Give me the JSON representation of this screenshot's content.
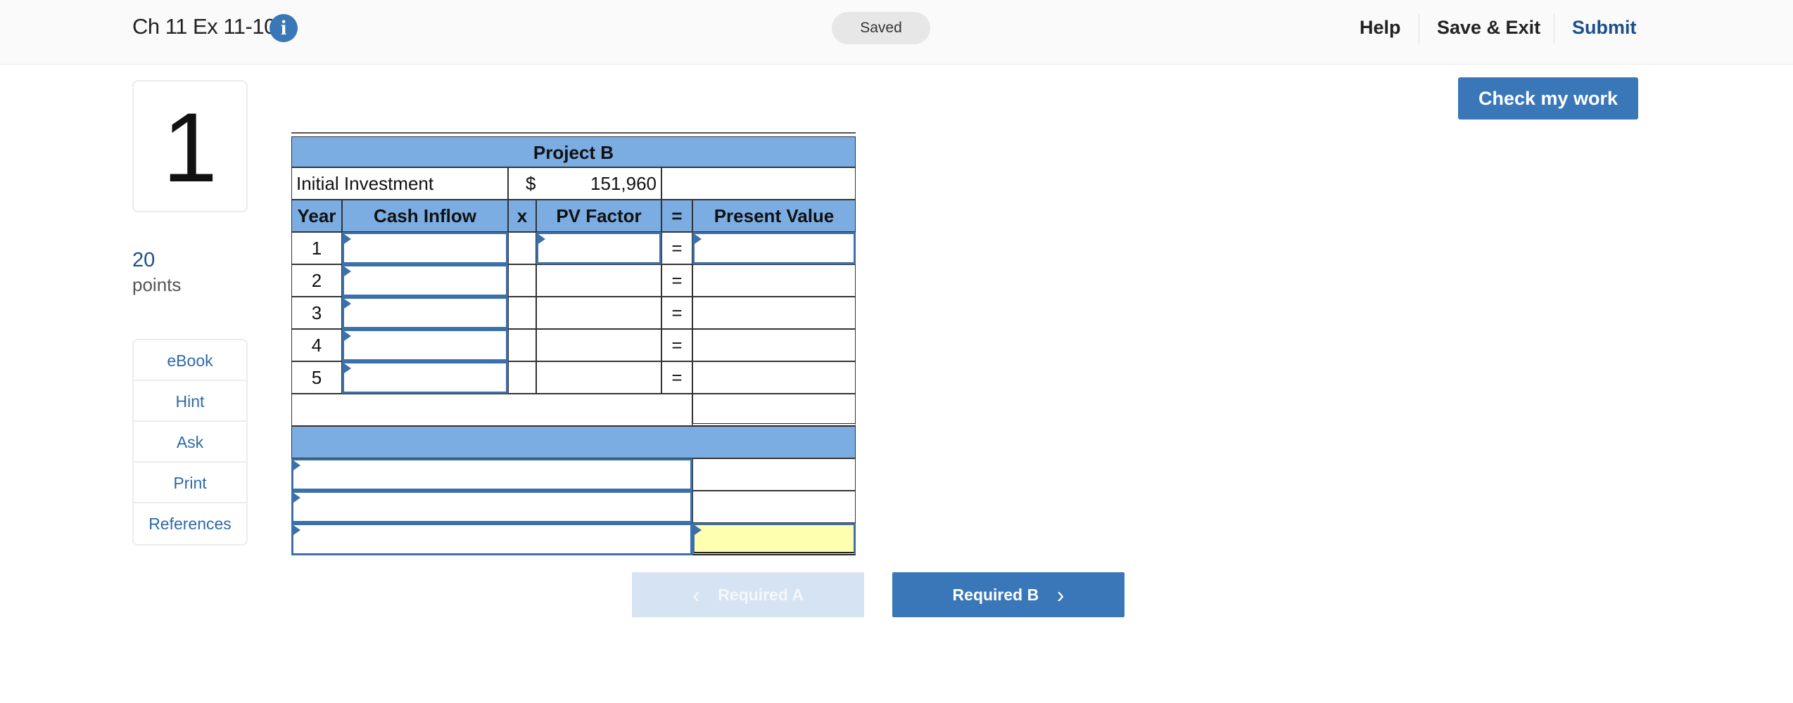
{
  "header": {
    "title": "Ch 11 Ex 11-10",
    "info_icon": "info-icon",
    "status": "Saved",
    "help": "Help",
    "save_exit": "Save & Exit",
    "submit": "Submit"
  },
  "question": {
    "number": "1",
    "points_value": "20",
    "points_label": "points"
  },
  "tools": [
    "eBook",
    "Hint",
    "Ask",
    "Print",
    "References"
  ],
  "check_button": "Check my work",
  "table": {
    "title": "Project B",
    "initial_investment_label": "Initial Investment",
    "currency": "$",
    "initial_investment_value": "151,960",
    "headers": {
      "year": "Year",
      "cash_inflow": "Cash Inflow",
      "times": "x",
      "pv_factor": "PV Factor",
      "equals": "=",
      "present_value": "Present Value"
    },
    "years": [
      "1",
      "2",
      "3",
      "4",
      "5"
    ],
    "equals_sign": "="
  },
  "nav": {
    "prev": "Required A",
    "next": "Required B"
  },
  "colors": {
    "accent": "#3a77b8",
    "header_blue": "#7bade2",
    "highlight_yellow": "#ffffb0"
  }
}
